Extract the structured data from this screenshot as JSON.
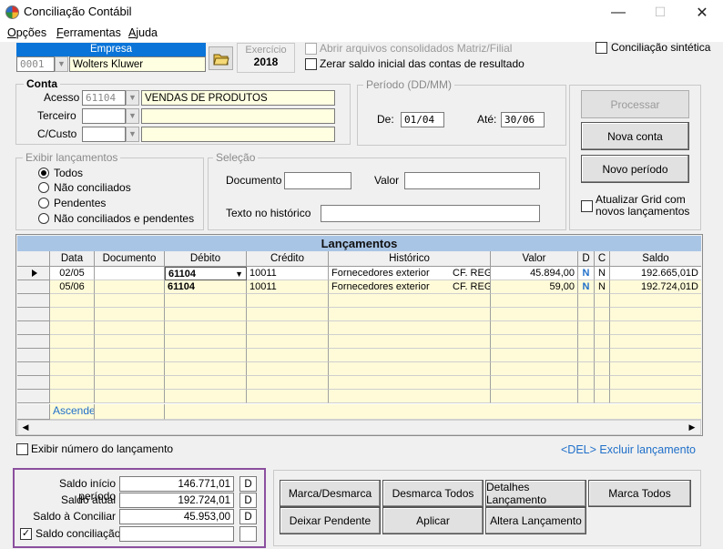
{
  "window": {
    "title": "Conciliação Contábil",
    "minimize": "—",
    "maximize": "☐",
    "close": "✕"
  },
  "menu": [
    {
      "pre": "",
      "u": "O",
      "post": "pções"
    },
    {
      "pre": "",
      "u": "F",
      "post": "erramentas"
    },
    {
      "pre": "",
      "u": "A",
      "post": "juda"
    }
  ],
  "empresa": {
    "header": "Empresa",
    "code": "0001",
    "name": "Wolters Kluwer",
    "exercicio_label": "Exercício",
    "exercicio": "2018"
  },
  "options": {
    "abrir_arquivos": "Abrir arquivos consolidados Matriz/Filial",
    "zerar_saldo": "Zerar saldo inicial das contas de resultado",
    "conciliacao_sintetica": "Conciliação sintética"
  },
  "conta": {
    "title": "Conta",
    "acesso_label": "Acesso",
    "acesso_code": "61104",
    "acesso_desc": "VENDAS DE PRODUTOS",
    "terceiro_label": "Terceiro",
    "ccusto_label": "C/Custo"
  },
  "periodo": {
    "title": "Período (DD/MM)",
    "de_label": "De:",
    "de": "01/04",
    "ate_label": "Até:",
    "ate": "30/06"
  },
  "buttons_right": {
    "processar": "Processar",
    "nova_conta": "Nova conta",
    "novo_periodo": "Novo período",
    "atualizar_grid": "Atualizar Grid com novos lançamentos"
  },
  "exibir": {
    "title": "Exibir lançamentos",
    "options": [
      "Todos",
      "Não conciliados",
      "Pendentes",
      "Não conciliados e pendentes"
    ],
    "selected": 0
  },
  "selecao": {
    "title": "Seleção",
    "documento_label": "Documento",
    "valor_label": "Valor",
    "texto_label": "Texto no histórico"
  },
  "grid": {
    "title": "Lançamentos",
    "columns": [
      "Data",
      "Documento",
      "Débito",
      "Crédito",
      "Histórico",
      "Valor",
      "D",
      "C",
      "Saldo"
    ],
    "rows": [
      {
        "data": "02/05",
        "documento": "",
        "debito": "61104",
        "credito": "10011",
        "historico": "Fornecedores exterior",
        "hist_ref": "CF. REG",
        "valor": "45.894,00",
        "d": "N",
        "c": "N",
        "saldo": "192.665,01D"
      },
      {
        "data": "05/06",
        "documento": "",
        "debito": "61104",
        "credito": "10011",
        "historico": "Fornecedores exterior",
        "hist_ref": "CF. REG",
        "valor": "59,00",
        "d": "N",
        "c": "N",
        "saldo": "192.724,01D"
      }
    ],
    "footer_order": "Ascende",
    "empty_rows": 8
  },
  "exibir_numero": "Exibir número do lançamento",
  "del_hint": "<DEL> Excluir lançamento",
  "saldos": {
    "inicio_label": "Saldo início período",
    "inicio": "146.771,01",
    "inicio_dc": "D",
    "atual_label": "Saldo atual",
    "atual": "192.724,01",
    "atual_dc": "D",
    "conciliar_label": "Saldo à Conciliar",
    "conciliar": "45.953,00",
    "conciliar_dc": "D",
    "conciliacao_label": "Saldo conciliação",
    "conciliacao": "",
    "conciliacao_dc": ""
  },
  "actions": {
    "marca_desmarca": "Marca/Desmarca",
    "desmarca_todos": "Desmarca Todos",
    "detalhes": "Detalhes Lançamento",
    "marca_todos": "Marca Todos",
    "deixar_pendente": "Deixar Pendente",
    "aplicar": "Aplicar",
    "altera": "Altera Lançamento"
  },
  "colors": {
    "grid_header": "#a9c5e6",
    "row_selected": "#fffbd9",
    "link_blue": "#1f6fc9",
    "saldo_border": "#8b4f9e"
  }
}
